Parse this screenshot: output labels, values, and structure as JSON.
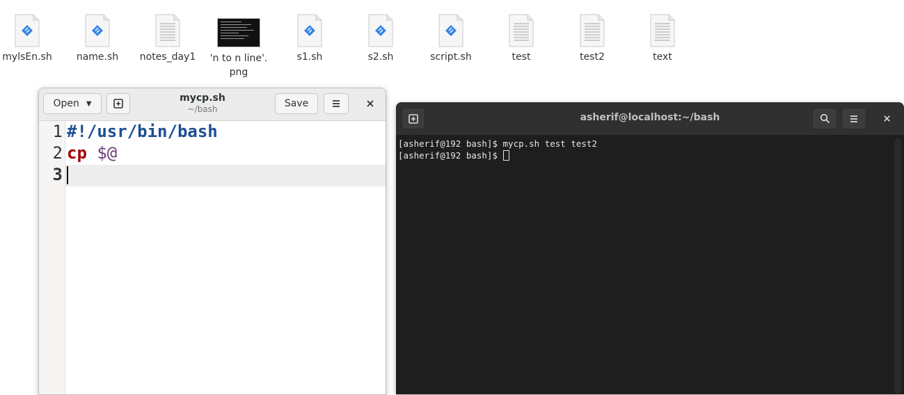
{
  "desktop": {
    "icons": [
      {
        "label": "mylsEn.sh",
        "type": "script"
      },
      {
        "label": "name.sh",
        "type": "script"
      },
      {
        "label": "notes_day1",
        "type": "text"
      },
      {
        "label": "'n to n line'.\npng",
        "type": "image"
      },
      {
        "label": "s1.sh",
        "type": "script"
      },
      {
        "label": "s2.sh",
        "type": "script"
      },
      {
        "label": "script.sh",
        "type": "script"
      },
      {
        "label": "test",
        "type": "text"
      },
      {
        "label": "test2",
        "type": "text"
      },
      {
        "label": "text",
        "type": "text"
      }
    ]
  },
  "gedit": {
    "title": "mycp.sh",
    "subtitle": "~/bash",
    "open_label": "Open",
    "save_label": "Save",
    "line_numbers": [
      "1",
      "2",
      "3"
    ],
    "lines": {
      "l1": "#!/usr/bin/bash",
      "l2_kw": "cp",
      "l2_var": "$@"
    },
    "icons": [
      "chevron-down-icon",
      "new-tab-icon",
      "hamburger-menu-icon",
      "close-icon"
    ]
  },
  "terminal": {
    "title": "asherif@localhost:~/bash",
    "lines": [
      "[asherif@192 bash]$ mycp.sh test test2",
      "[asherif@192 bash]$ "
    ],
    "icons": [
      "new-tab-icon",
      "search-icon",
      "hamburger-menu-icon",
      "close-icon"
    ]
  },
  "colors": {
    "terminal_bg": "#1e1e1e",
    "shebang": "#1c4e93",
    "keyword": "#a40000",
    "variable": "#6d3d7a",
    "script_icon": "#3584e4"
  }
}
